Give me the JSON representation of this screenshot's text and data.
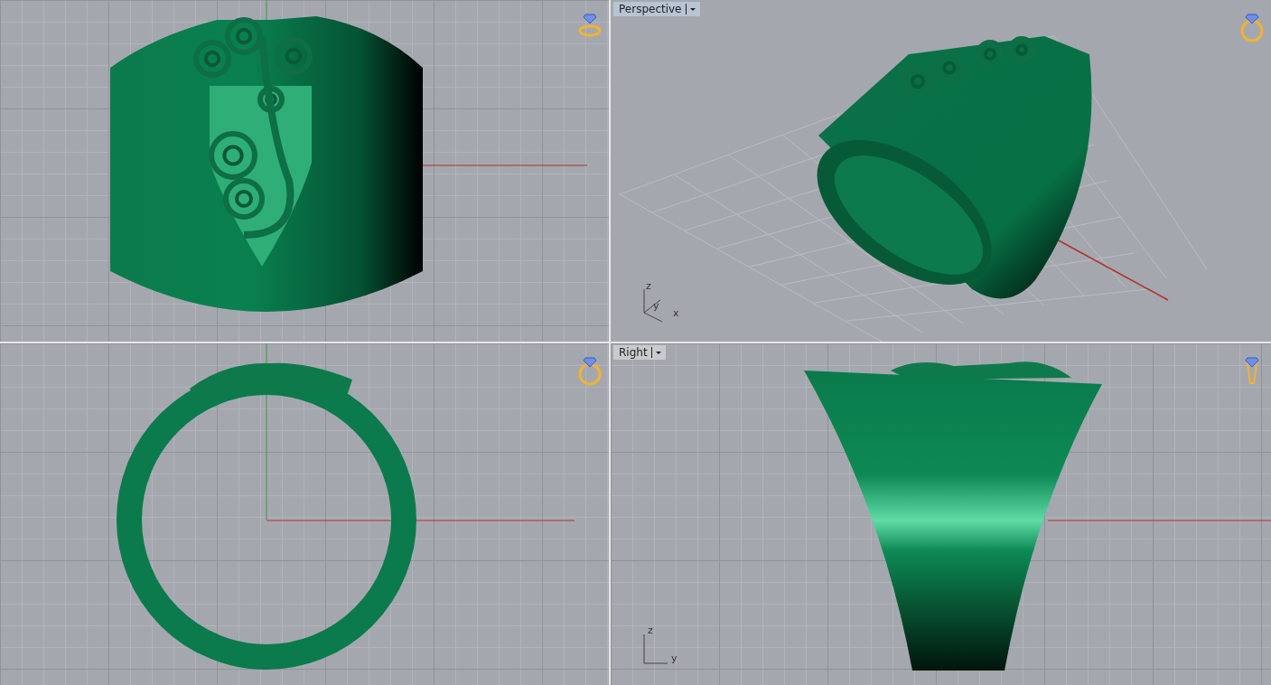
{
  "viewports": [
    {
      "kind": "top"
    },
    {
      "kind": "perspective",
      "label": "Perspective",
      "axes": [
        "z",
        "y",
        "x"
      ]
    },
    {
      "kind": "front"
    },
    {
      "kind": "right",
      "label": "Right",
      "axes": [
        "z",
        "y"
      ]
    }
  ]
}
